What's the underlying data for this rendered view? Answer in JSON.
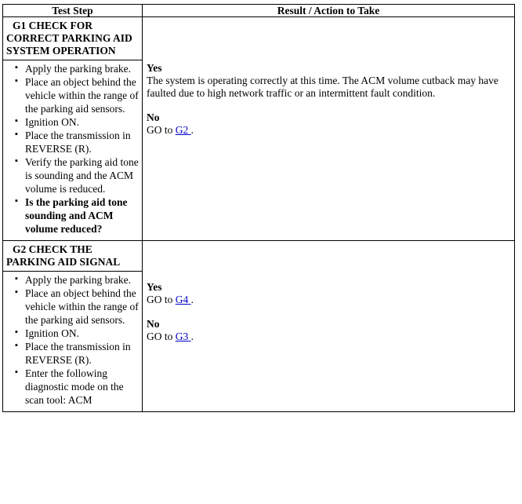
{
  "table": {
    "headers": {
      "step": "Test Step",
      "result": "Result / Action to Take"
    },
    "link_color": "#0000cc",
    "rows": [
      {
        "id": "G1",
        "title_lines": [
          "G1 CHECK FOR",
          "CORRECT PARKING AID",
          "SYSTEM OPERATION"
        ],
        "steps": [
          {
            "text": "Apply the parking brake.",
            "bold": false
          },
          {
            "text": "Place an object behind the vehicle within the range of the parking aid sensors.",
            "bold": false
          },
          {
            "text": "Ignition ON.",
            "bold": false
          },
          {
            "text": "Place the transmission in REVERSE (R).",
            "bold": false
          },
          {
            "text": "Verify the parking aid tone is sounding and the ACM volume is reduced.",
            "bold": false
          },
          {
            "text": "Is the parking aid tone sounding and ACM volume reduced?",
            "bold": true
          }
        ],
        "result": {
          "yes_label": "Yes",
          "yes_text": "The system is operating correctly at this time. The ACM volume cutback may have faulted due to high network traffic or an intermittent fault condition.",
          "no_label": "No",
          "no_prefix": "GO to",
          "no_link": "G2",
          "no_suffix": "."
        }
      },
      {
        "id": "G2",
        "title_lines": [
          "G2 CHECK THE",
          "PARKING AID SIGNAL"
        ],
        "steps": [
          {
            "text": "Apply the parking brake.",
            "bold": false
          },
          {
            "text": "Place an object behind the vehicle within the range of the parking aid sensors.",
            "bold": false
          },
          {
            "text": "Ignition ON.",
            "bold": false
          },
          {
            "text": "Place the transmission in REVERSE (R).",
            "bold": false
          },
          {
            "text": "Enter the following diagnostic mode on the scan tool: ACM",
            "bold": false
          }
        ],
        "result": {
          "yes_label": "Yes",
          "yes_prefix": "GO to",
          "yes_link": "G4",
          "yes_suffix": ".",
          "no_label": "No",
          "no_prefix": "GO to",
          "no_link": "G3",
          "no_suffix": "."
        }
      }
    ]
  }
}
